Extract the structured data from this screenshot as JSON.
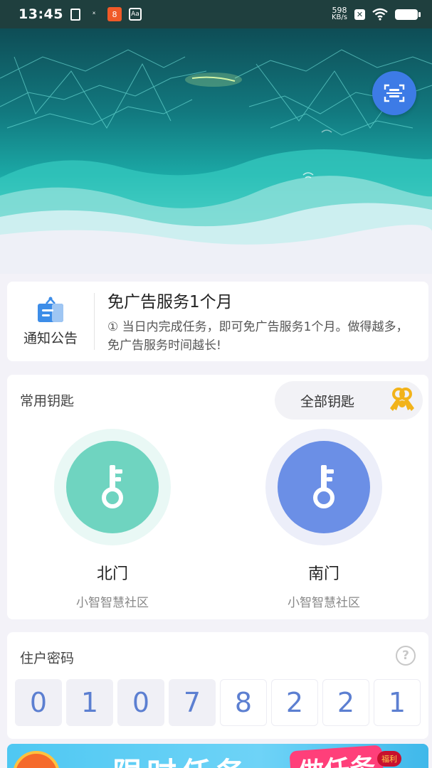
{
  "status_bar": {
    "time": "13:45",
    "net_speed_value": "598",
    "net_speed_unit": "KB/s",
    "icons": [
      "clipboard-icon",
      "usb-icon",
      "app-notification-icon",
      "accessibility-icon",
      "x-app-icon",
      "wifi-icon",
      "battery-icon"
    ],
    "orange_icon_text": "8",
    "box_icon_text": "Aa"
  },
  "hero": {
    "scan_icon": "scan-qr-icon",
    "accent": "#3d7be6"
  },
  "notice": {
    "label": "通知公告",
    "title": "免广告服务1个月",
    "text": "① 当日内完成任务，即可免广告服务1个月。做得越多，免广告服务时间越长!"
  },
  "keys": {
    "section_title": "常用钥匙",
    "all_keys_label": "全部钥匙",
    "items": [
      {
        "name": "北门",
        "community": "小智智慧社区",
        "color": "#6fd4c0",
        "halo": "#e9f8f5"
      },
      {
        "name": "南门",
        "community": "小智智慧社区",
        "color": "#6b8fe6",
        "halo": "#eceef9"
      }
    ]
  },
  "password": {
    "section_title": "住户密码",
    "help_icon_text": "?",
    "digits": [
      "0",
      "1",
      "0",
      "7",
      "8",
      "2",
      "2",
      "1"
    ]
  },
  "promo": {
    "title": "限时任务",
    "tag": "做任务",
    "mini_badge": "福利"
  }
}
